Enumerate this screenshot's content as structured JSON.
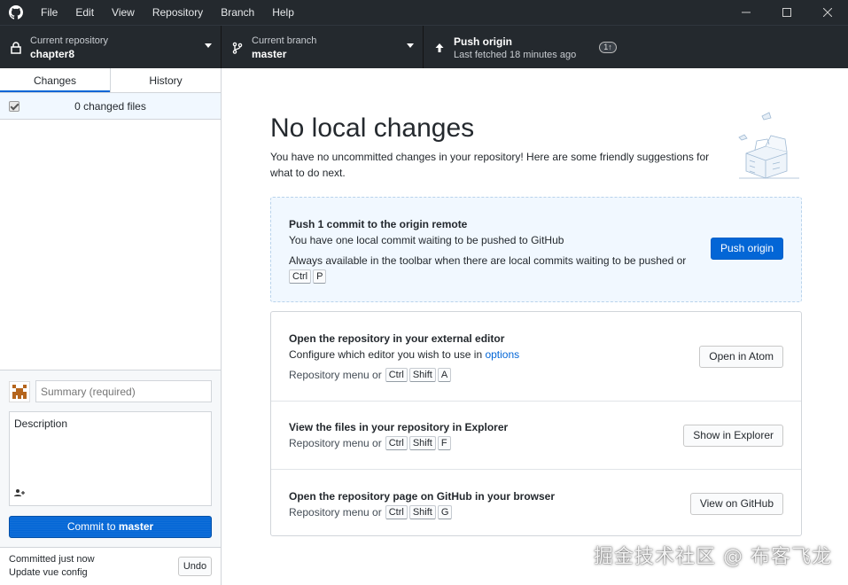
{
  "menu": [
    "File",
    "Edit",
    "View",
    "Repository",
    "Branch",
    "Help"
  ],
  "window_controls": {
    "minimize": "—",
    "maximize": "☐",
    "close": "✕"
  },
  "toolbar": {
    "repo_label": "Current repository",
    "repo_value": "chapter8",
    "branch_label": "Current branch",
    "branch_value": "master",
    "push_title": "Push origin",
    "push_subtitle": "Last fetched 18 minutes ago",
    "push_badge": "1↑"
  },
  "sidebar": {
    "tabs": [
      "Changes",
      "History"
    ],
    "changed_files": "0 changed files",
    "summary_placeholder": "Summary (required)",
    "description_placeholder": "Description",
    "commit_prefix": "Commit to ",
    "commit_branch": "master",
    "last_commit_time": "Committed just now",
    "last_commit_message": "Update vue config",
    "undo_label": "Undo"
  },
  "main": {
    "heading": "No local changes",
    "subtext": "You have no uncommitted changes in your repository! Here are some friendly suggestions for what to do next.",
    "push_card": {
      "title": "Push 1 commit to the origin remote",
      "desc": "You have one local commit waiting to be pushed to GitHub",
      "hint": "Always available in the toolbar when there are local commits waiting to be pushed or",
      "keys": [
        "Ctrl",
        "P"
      ],
      "button": "Push origin"
    },
    "editor_card": {
      "title": "Open the repository in your external editor",
      "desc_prefix": "Configure which editor you wish to use in ",
      "desc_link": "options",
      "hint": "Repository menu or",
      "keys": [
        "Ctrl",
        "Shift",
        "A"
      ],
      "button": "Open in Atom"
    },
    "explorer_card": {
      "title": "View the files in your repository in Explorer",
      "hint": "Repository menu or",
      "keys": [
        "Ctrl",
        "Shift",
        "F"
      ],
      "button": "Show in Explorer"
    },
    "github_card": {
      "title": "Open the repository page on GitHub in your browser",
      "hint": "Repository menu or",
      "keys": [
        "Ctrl",
        "Shift",
        "G"
      ],
      "button": "View on GitHub"
    }
  },
  "watermark": "掘金技术社区 @ 布客飞龙",
  "colors": {
    "accent": "#0366d6",
    "titlebar": "#24292e",
    "highlight": "#f1f8ff"
  }
}
